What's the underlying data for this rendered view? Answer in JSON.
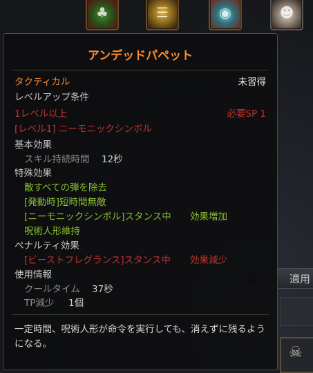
{
  "bg_buttons": {
    "apply_label": "適用"
  },
  "skill_icons": [
    {
      "name": "plant-skill-icon"
    },
    {
      "name": "gold-skill-icon"
    },
    {
      "name": "pot-skill-icon"
    },
    {
      "name": "mask-skill-icon"
    }
  ],
  "tooltip": {
    "title": "アンデッドパペット",
    "type": "タクティカル",
    "status": "未習得",
    "levelup": {
      "title": "レベルアップ条件",
      "level_req": "1レベル以上",
      "sp_req": "必要SP 1",
      "skill_req": "[レベル1] ニーモニックシンボル"
    },
    "basic": {
      "title": "基本効果",
      "duration_label": "スキル持続時間",
      "duration_value": "12秒"
    },
    "special": {
      "title": "特殊効果",
      "items": [
        "敵すべての弾を除去",
        "[発動時]短時間無敵",
        "[ニーモニックシンボル]スタンス中",
        "呪術人形維持"
      ],
      "item3_effect": "効果増加"
    },
    "penalty": {
      "title": "ペナルティ効果",
      "item": "[ビーストフレグランス]スタンス中",
      "effect": "効果減少"
    },
    "usage": {
      "title": "使用情報",
      "cooldown_label": "クールタイム",
      "cooldown_value": "37秒",
      "tp_label": "TP減少",
      "tp_value": "1個"
    },
    "description": "一定時間、呪術人形が命令を実行しても、消えずに残るようになる。"
  },
  "colors": {
    "title_orange": "#ff8c2f",
    "requirement_red": "#c0342c",
    "effect_green": "#86c02d",
    "label_gray": "#c8c8c8"
  }
}
